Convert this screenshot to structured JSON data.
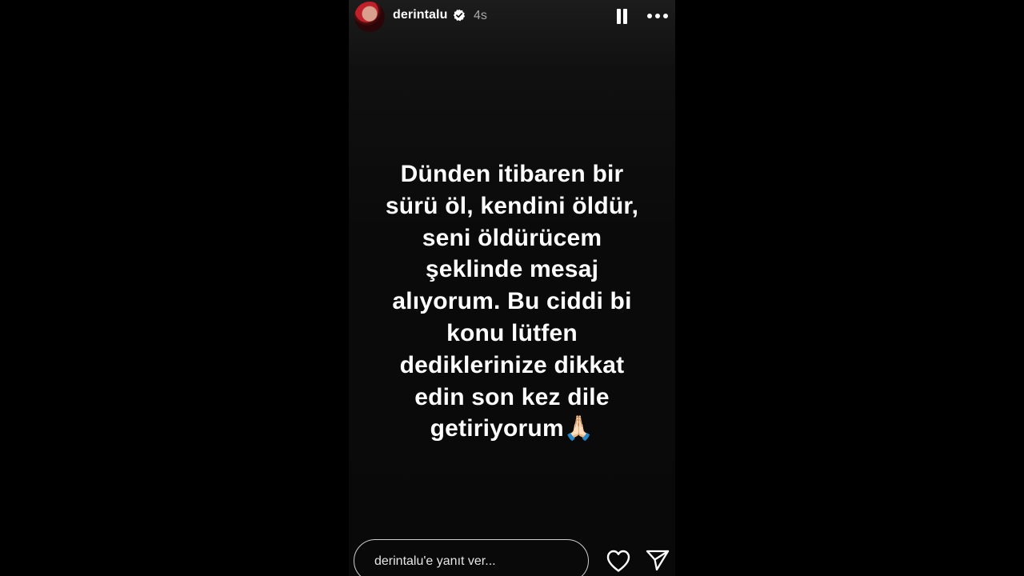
{
  "story": {
    "username": "derintalu",
    "time": "4s",
    "message": "Dünden itibaren bir\nsürü öl, kendini öldür,\nseni öldürücem\nşeklinde mesaj\nalıyorum. Bu ciddi bi\nkonu lütfen\ndediklerinize dikkat\nedin son kez dile\ngetiriyorum🙏🏻",
    "reply_placeholder": "derintalu'e yanıt ver..."
  },
  "icons": {
    "verified": "verified-badge-icon",
    "pause": "pause-icon",
    "more": "more-options-icon",
    "heart": "heart-icon",
    "send": "send-icon"
  }
}
